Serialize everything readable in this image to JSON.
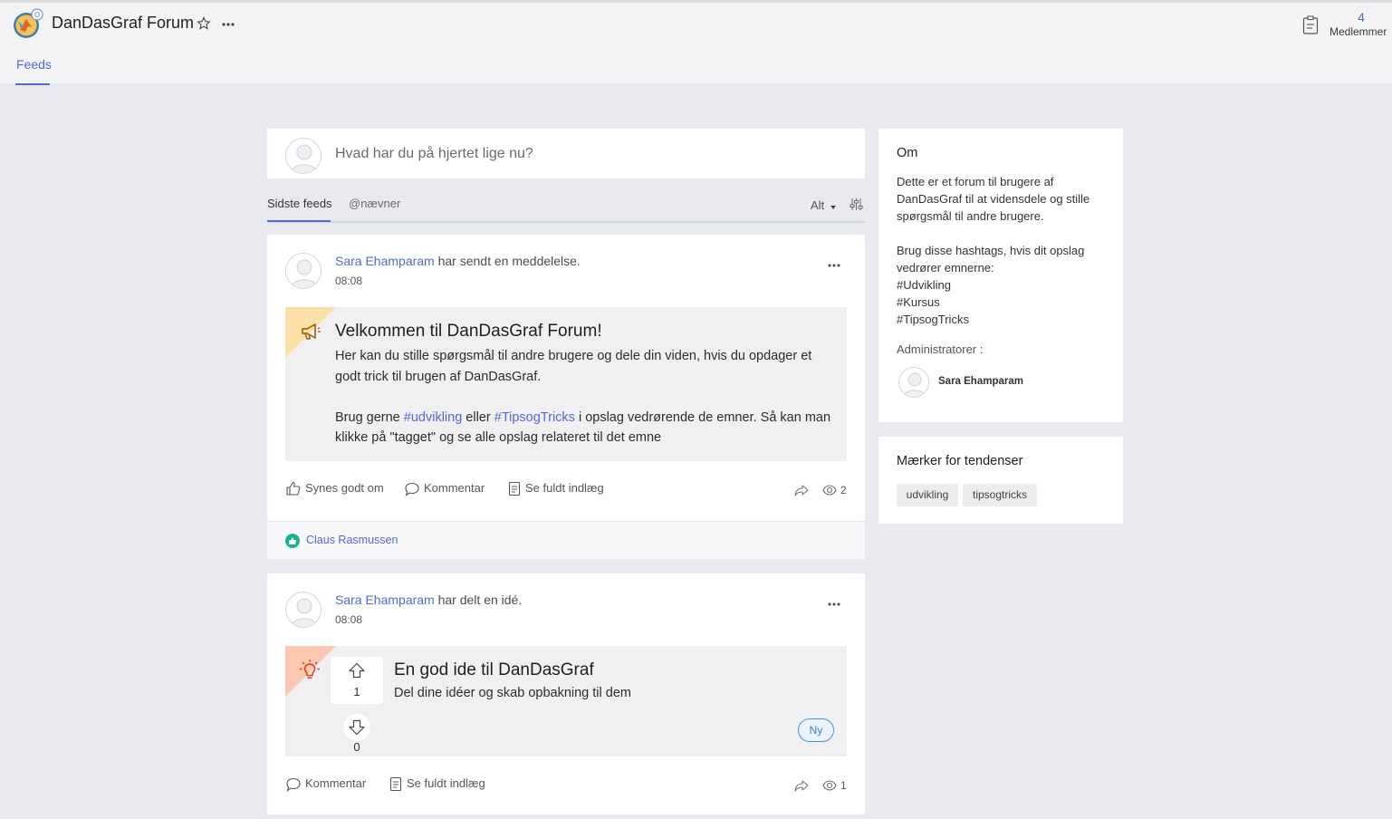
{
  "header": {
    "forum_title": "DanDasGraf Forum",
    "members_count": "4",
    "members_label": "Medlemmer",
    "tab_feeds": "Feeds",
    "accent_color": "#5468d4"
  },
  "composer": {
    "placeholder": "Hvad har du på hjertet lige nu?"
  },
  "feed_tabs": {
    "latest": "Sidste feeds",
    "mentions": "@nævner",
    "filter_value": "Alt"
  },
  "posts": [
    {
      "author": "Sara Ehamparam",
      "action": " har sendt en meddelelse.",
      "time": "08:08",
      "title": "Velkommen til DanDasGraf Forum!",
      "body_1": "Her kan du stille spørgsmål til andre brugere og dele din viden, hvis du opdager et godt trick til brugen af DanDasGraf.",
      "body_2_a": "Brug gerne ",
      "hashtag_1": "#udvikling",
      "body_2_b": " eller ",
      "hashtag_2": "#TipsogTricks",
      "body_2_c": " i opslag vedrørende de emner. Så kan man klikke på \"tagget\" og se alle opslag relateret til det emne",
      "like_label": "Synes godt om",
      "comment_label": "Kommentar",
      "full_post_label": "Se fuldt indlæg",
      "views": "2",
      "liked_by": "Claus Rasmussen"
    },
    {
      "author": "Sara Ehamparam",
      "action": " har delt en idé.",
      "time": "08:08",
      "title": "En god ide til DanDasGraf",
      "subtitle": "Del dine idéer og skab opbakning til dem",
      "upvotes": "1",
      "downvotes": "0",
      "status": "Ny",
      "comment_label": "Kommentar",
      "full_post_label": "Se fuldt indlæg",
      "views": "1"
    }
  ],
  "sidebar": {
    "about_heading": "Om",
    "about_lines": [
      "Dette er et forum til brugere af",
      "DanDasGraf til at vidensdele og stille",
      "spørgsmål til andre brugere.",
      "",
      "Brug disse hashtags, hvis dit opslag",
      "vedrører emnerne:",
      "#Udvikling",
      "#Kursus",
      "#TipsogTricks"
    ],
    "admins_label": "Administratorer :",
    "admin_name": "Sara Ehamparam",
    "trends_heading": "Mærker for tendenser",
    "tags": [
      "udvikling",
      "tipsogtricks"
    ]
  }
}
